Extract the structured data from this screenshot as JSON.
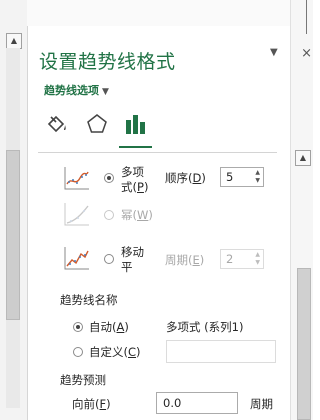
{
  "pane": {
    "title": "设置趋势线格式",
    "options_dropdown": "趋势线选项",
    "categories": [
      "fill-line-icon",
      "effects-icon",
      "trendline-options-icon"
    ],
    "accent_color": "#217346"
  },
  "trend_types": {
    "polynomial": {
      "label_line1": "多项",
      "label_line2_pre": "式(",
      "label_line2_key": "P",
      "label_line2_post": ")",
      "order_label_pre": "顺序(",
      "order_label_key": "D",
      "order_label_post": ")",
      "order_value": "5",
      "checked": true
    },
    "power": {
      "label_pre": "幂(",
      "label_key": "W",
      "label_post": ")",
      "checked": false,
      "disabled": true
    },
    "moving_average": {
      "label_line1": "移动",
      "label_line2": "平",
      "period_label_pre": "周期(",
      "period_label_key": "E",
      "period_label_post": ")",
      "period_value": "2",
      "checked": false
    }
  },
  "trendline_name": {
    "section_label": "趋势线名称",
    "auto": {
      "label_pre": "自动(",
      "label_key": "A",
      "label_post": ")",
      "value": "多项式 (系列1)",
      "checked": true
    },
    "custom": {
      "label_pre": "自定义(",
      "label_key": "C",
      "label_post": ")",
      "value": "",
      "checked": false
    }
  },
  "forecast": {
    "section_label": "趋势预测",
    "forward": {
      "label_pre": "向前(",
      "label_key": "F",
      "label_post": ")",
      "value": "0.0",
      "unit": "周期"
    }
  }
}
